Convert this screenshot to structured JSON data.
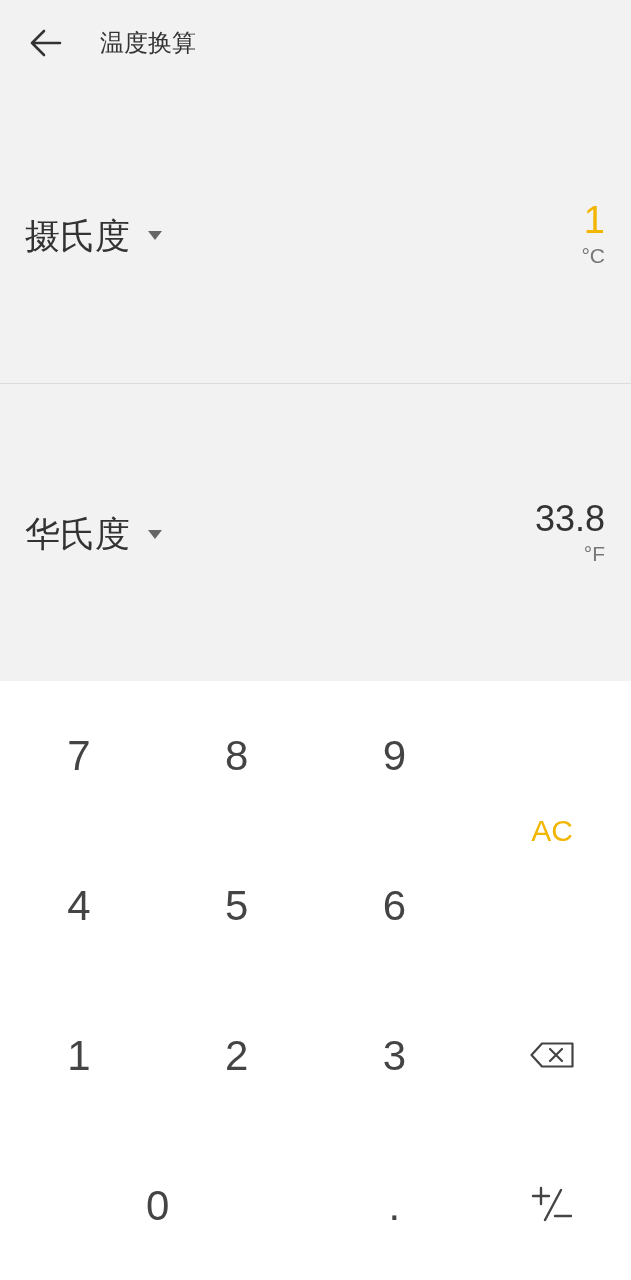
{
  "header": {
    "title": "温度换算"
  },
  "units": [
    {
      "name": "摄氏度",
      "value": "1",
      "symbol": "°C",
      "selected": true
    },
    {
      "name": "华氏度",
      "value": "33.8",
      "symbol": "°F",
      "selected": false
    }
  ],
  "keypad": [
    {
      "kind": "digit",
      "label": "7"
    },
    {
      "kind": "digit",
      "label": "8"
    },
    {
      "kind": "digit",
      "label": "9"
    },
    {
      "kind": "clear",
      "label": "AC"
    },
    {
      "kind": "digit",
      "label": "4"
    },
    {
      "kind": "digit",
      "label": "5"
    },
    {
      "kind": "digit",
      "label": "6"
    },
    {
      "kind": "digit",
      "label": "1"
    },
    {
      "kind": "digit",
      "label": "2"
    },
    {
      "kind": "digit",
      "label": "3"
    },
    {
      "kind": "backspace"
    },
    {
      "kind": "wide",
      "label": "0"
    },
    {
      "kind": "digit",
      "label": "."
    },
    {
      "kind": "sign"
    }
  ]
}
